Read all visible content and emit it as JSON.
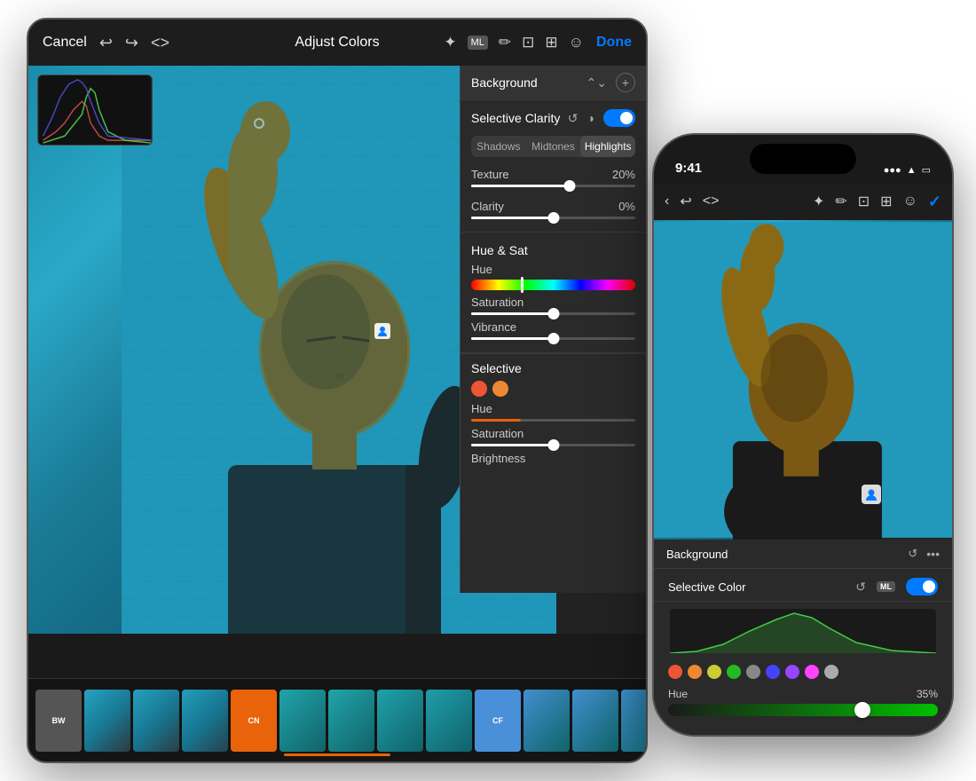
{
  "scene": {
    "background": "#ffffff"
  },
  "tablet": {
    "topbar": {
      "cancel_label": "Cancel",
      "undo_icon": "↩",
      "redo_icon": "↪",
      "code_icon": "<>",
      "title": "Adjust Colors",
      "done_label": "Done"
    },
    "panel": {
      "background_label": "Background",
      "selective_clarity_title": "Selective Clarity",
      "segments": [
        "Shadows",
        "Midtones",
        "Highlights"
      ],
      "active_segment": "Highlights",
      "texture_label": "Texture",
      "texture_value": "20%",
      "texture_pct": 60,
      "clarity_label": "Clarity",
      "clarity_value": "0%",
      "clarity_pct": 50,
      "hue_sat_title": "Hue & Sat",
      "hue_label": "Hue",
      "saturation_label": "Saturation",
      "vibrance_label": "Vibrance",
      "selective_label": "Selective"
    },
    "filmstrip": {
      "items": [
        {
          "type": "badge",
          "label": "BW",
          "variant": "bw"
        },
        {
          "type": "thumb"
        },
        {
          "type": "thumb"
        },
        {
          "type": "thumb"
        },
        {
          "type": "badge",
          "label": "CN",
          "variant": "cn"
        },
        {
          "type": "thumb"
        },
        {
          "type": "thumb"
        },
        {
          "type": "thumb"
        },
        {
          "type": "thumb"
        },
        {
          "type": "badge",
          "label": "CF",
          "variant": "cf"
        },
        {
          "type": "thumb"
        },
        {
          "type": "thumb"
        },
        {
          "type": "thumb"
        },
        {
          "type": "thumb"
        }
      ]
    }
  },
  "phone": {
    "statusbar": {
      "time": "9:41",
      "signal_icon": "▪▪▪",
      "wifi_icon": "wifi",
      "battery_icon": "🔋"
    },
    "toolbar": {
      "back_icon": "‹",
      "undo_icon": "↩",
      "code_icon": "<>",
      "check_icon": "✓"
    },
    "panel": {
      "background_label": "Background",
      "selective_color_label": "Selective Color",
      "ml_label": "ML",
      "hue_label": "Hue",
      "hue_value": "35%",
      "swatches": [
        "#e53",
        "#e63",
        "#e83",
        "#2b2",
        "#2cc",
        "#44f",
        "#94f",
        "#f4f",
        "#aaa"
      ]
    }
  },
  "icons": {
    "undo": "↩",
    "redo": "↪",
    "pencil": "✏",
    "crop": "⊡",
    "grid": "⊞",
    "emoji": "☺",
    "wand": "✦",
    "ml": "ML",
    "chevron": "⌃",
    "plus": "+",
    "reset": "↺",
    "ml_small": "ML",
    "toggle": "toggle",
    "check": "✓",
    "person": "👤"
  },
  "colors": {
    "accent": "#007AFF",
    "orange": "#e8630a",
    "panel_bg": "#2a2a2a",
    "topbar_bg": "#1e1e1e",
    "toggle_active": "#007AFF",
    "highlights_active": "#4a4a4a"
  }
}
